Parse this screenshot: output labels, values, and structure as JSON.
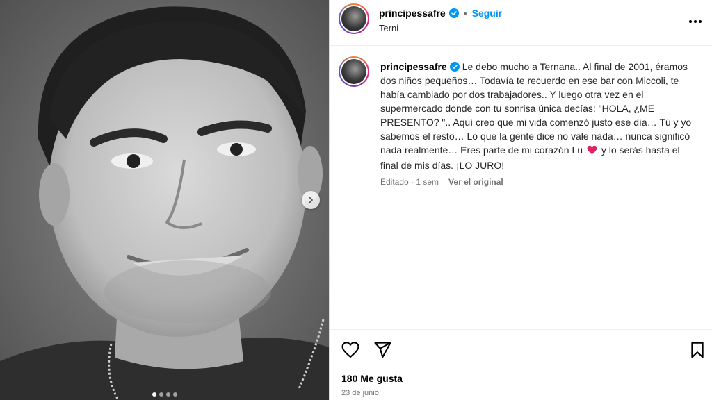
{
  "post": {
    "username": "principessafre",
    "follow_label": "Seguir",
    "separator": "•",
    "location": "Terni",
    "caption": "Le debo mucho a Ternana.. Al final de 2001, éramos dos niños pequeños… Todavía te recuerdo en ese bar con Miccoli, te había cambiado por dos trabajadores.. Y luego otra vez en el supermercado donde con tu sonrisa única decías: \"HOLA, ¿ME PRESENTO? \".. Aquí creo que mi vida comenzó justo ese día… Tú y yo sabemos el resto… Lo que la gente dice no vale nada… nunca significó nada realmente… Eres parte de mi corazón Lu",
    "caption_end": "y lo serás hasta el final de mis días. ¡LO JURO!",
    "edited_label": "Editado · 1 sem",
    "see_original_label": "Ver el original",
    "likes_label": "180 Me gusta",
    "date_label": "23 de junio"
  },
  "carousel": {
    "total_slides": 4,
    "active_slide": 1
  },
  "icons": {
    "verified": "verified-badge-icon",
    "more": "more-options-icon",
    "like": "heart-outline-icon",
    "share": "paper-plane-icon",
    "save": "bookmark-icon",
    "next": "chevron-right-icon",
    "emoji": "red-heart-emoji"
  },
  "colors": {
    "accent": "#0095f6",
    "text": "#262626",
    "secondary": "#737373",
    "heart_emoji": "#e0245e"
  }
}
